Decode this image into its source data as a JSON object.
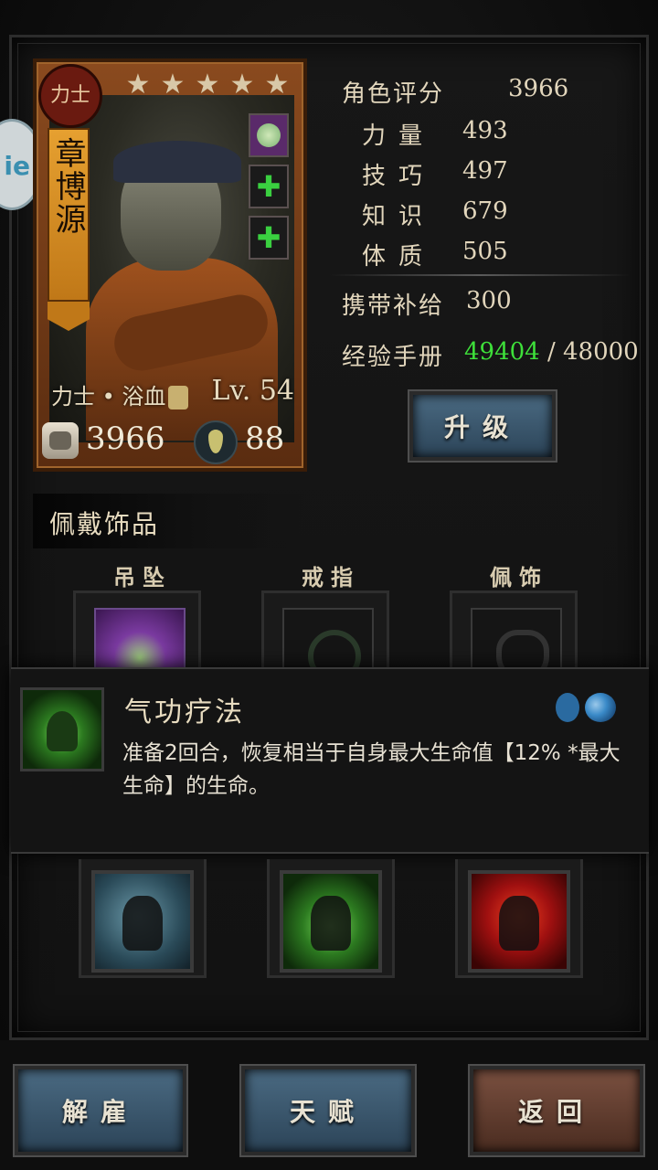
{
  "hero": {
    "class_seal": "力士",
    "name": "章博源",
    "stars": [
      "★",
      "★",
      "★",
      "★",
      "★"
    ],
    "class_line": "力士 • 浴血",
    "level": "Lv. 54",
    "power": "3966",
    "stress": "88",
    "equipped_icons": [
      "trinket-gem-icon",
      "add-plus-icon",
      "add-plus-icon"
    ]
  },
  "stats": {
    "rating_label": "角色评分",
    "rating_value": "3966",
    "strength_label": "力量",
    "strength_value": "493",
    "skill_label": "技巧",
    "skill_value": "497",
    "knowledge_label": "知识",
    "knowledge_value": "679",
    "constitution_label": "体质",
    "constitution_value": "505",
    "supply_label": "携带补给",
    "supply_value": "300",
    "exp_label": "经验手册",
    "exp_current": "49404",
    "exp_sep": " / ",
    "exp_max": "48000"
  },
  "buttons": {
    "upgrade": "升级",
    "dismiss": "解雇",
    "talent": "天赋",
    "back": "返回"
  },
  "trinkets": {
    "section_title": "佩戴饰品",
    "slots": [
      {
        "label": "吊坠"
      },
      {
        "label": "戒指"
      },
      {
        "label": "佩饰"
      }
    ]
  },
  "skill_tooltip": {
    "name": "气功疗法",
    "description": "准备2回合，恢复相当于自身最大生命值【12% *最大生命】的生命。",
    "icons": [
      "drop-range-icon",
      "yin-yang-range-icon"
    ]
  },
  "skills": [
    "running-strike-skill-icon",
    "qigong-heal-skill-icon",
    "blood-rage-skill-icon"
  ],
  "colors": {
    "exp_current": "#3ee03a",
    "button_blue": "#3a5a72",
    "button_brown": "#6a4232",
    "card_orange": "#8a4a1e"
  },
  "side_tab": "ie"
}
